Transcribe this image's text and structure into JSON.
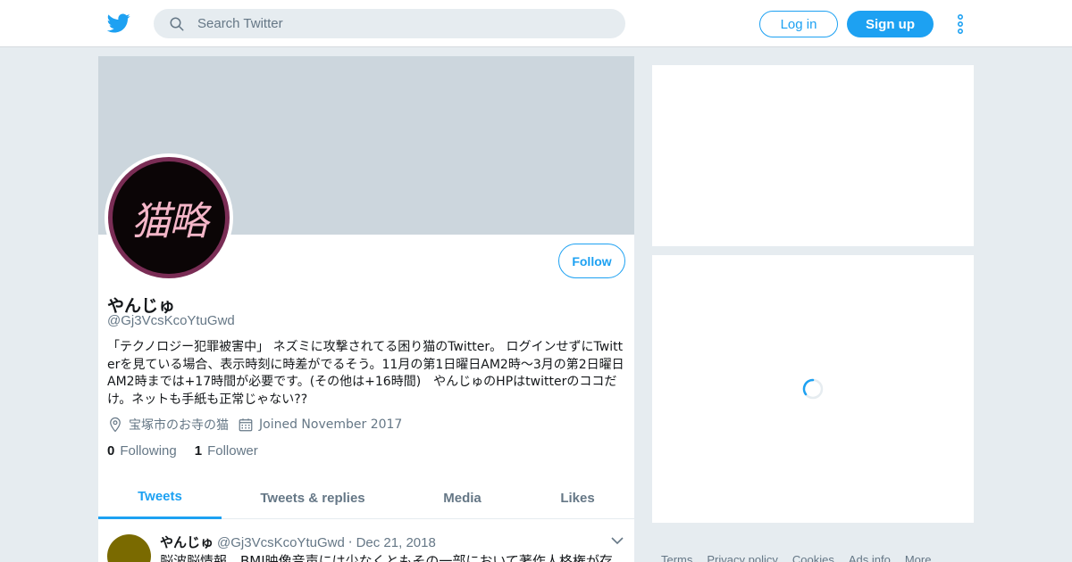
{
  "header": {
    "search_placeholder": "Search Twitter",
    "login_label": "Log in",
    "signup_label": "Sign up"
  },
  "profile": {
    "avatar_text": "猫略",
    "follow_label": "Follow",
    "name": "やんじゅ",
    "handle": "@Gj3VcsKcoYtuGwd",
    "bio": "「テクノロジー犯罪被害中」 ネズミに攻撃されてる困り猫のTwitter。 ログインせずにTwitterを見ている場合、表示時刻に時差がでるそう。11月の第1日曜日AM2時～3月の第2日曜日AM2時までは+17時間が必要です。(その他は+16時間)　やんじゅのHPはtwitterのココだけ。ネットも手紙も正常じゃない??",
    "location": "宝塚市のお寺の猫",
    "joined": "Joined November 2017",
    "following_count": "0",
    "following_label": "Following",
    "followers_count": "1",
    "followers_label": "Follower"
  },
  "tabs": [
    {
      "label": "Tweets",
      "active": true
    },
    {
      "label": "Tweets & replies",
      "active": false
    },
    {
      "label": "Media",
      "active": false
    },
    {
      "label": "Likes",
      "active": false
    }
  ],
  "tweet": {
    "name": "やんじゅ",
    "handle": "@Gj3VcsKcoYtuGwd",
    "separator": "·",
    "date": "Dec 21, 2018",
    "text": "脳波脳情報、BMI映像音声には少なくともその一部において著作人格権が存"
  },
  "footer": [
    "Terms",
    "Privacy policy",
    "Cookies",
    "Ads info",
    "More"
  ],
  "colors": {
    "accent": "#1da1f2",
    "background": "#e6ecf0",
    "banner": "#ccd6dd",
    "muted": "#657786"
  },
  "icons": [
    "twitter-logo-icon",
    "search-icon",
    "more-vertical-icon",
    "location-icon",
    "calendar-icon",
    "chevron-down-icon",
    "loading-spinner-icon"
  ]
}
